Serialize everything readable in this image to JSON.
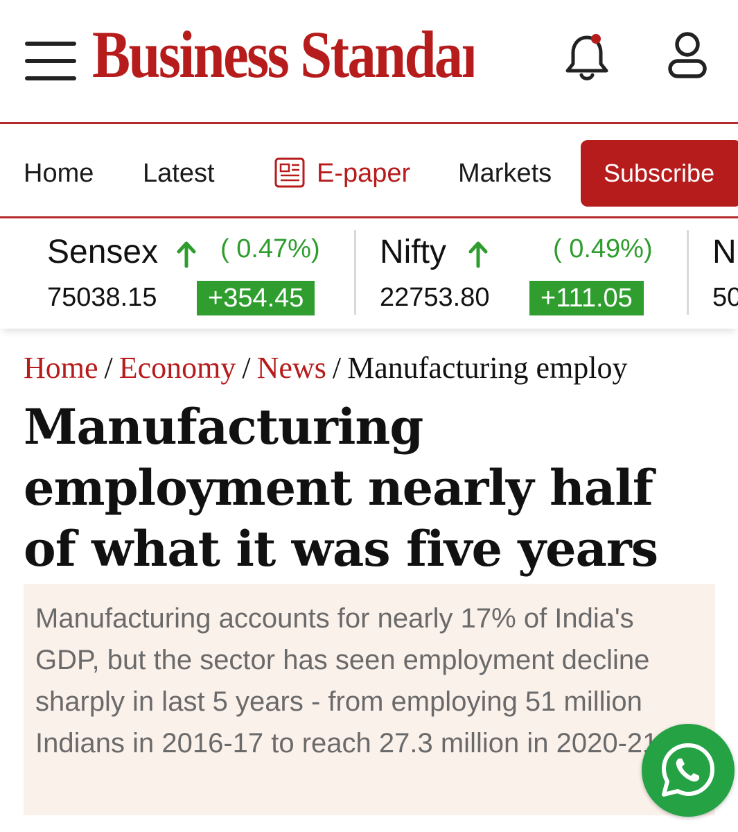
{
  "header": {
    "logo_text": "Business Standard",
    "colors": {
      "brand": "#b71c1c",
      "text": "#1a1a1a"
    }
  },
  "nav": {
    "home": "Home",
    "latest": "Latest",
    "epaper": "E-paper",
    "markets": "Markets",
    "subscribe": "Subscribe"
  },
  "ticker": [
    {
      "name": "Sensex",
      "direction": "up",
      "percent": "( 0.47%)",
      "value": "75038.15",
      "change": "+354.45"
    },
    {
      "name": "Nifty",
      "direction": "up",
      "percent": "( 0.49%)",
      "value": "22753.80",
      "change": "+111.05"
    },
    {
      "name": "N",
      "value": "50"
    }
  ],
  "breadcrumb": {
    "home": "Home",
    "economy": "Economy",
    "news": "News",
    "current": "Manufacturing employ"
  },
  "article": {
    "headline": "Manufacturing employment nearly half of what it was five years ago",
    "summary": "Manufacturing accounts for nearly 17% of India's GDP, but the sector has seen employment decline sharply in last 5 years - from employing 51 million Indians in 2016-17 to reach 27.3 million in 2020-21"
  },
  "icons": [
    "menu-icon",
    "notification-bell-icon",
    "user-icon",
    "epaper-icon",
    "arrow-up-icon",
    "whatsapp-icon"
  ]
}
